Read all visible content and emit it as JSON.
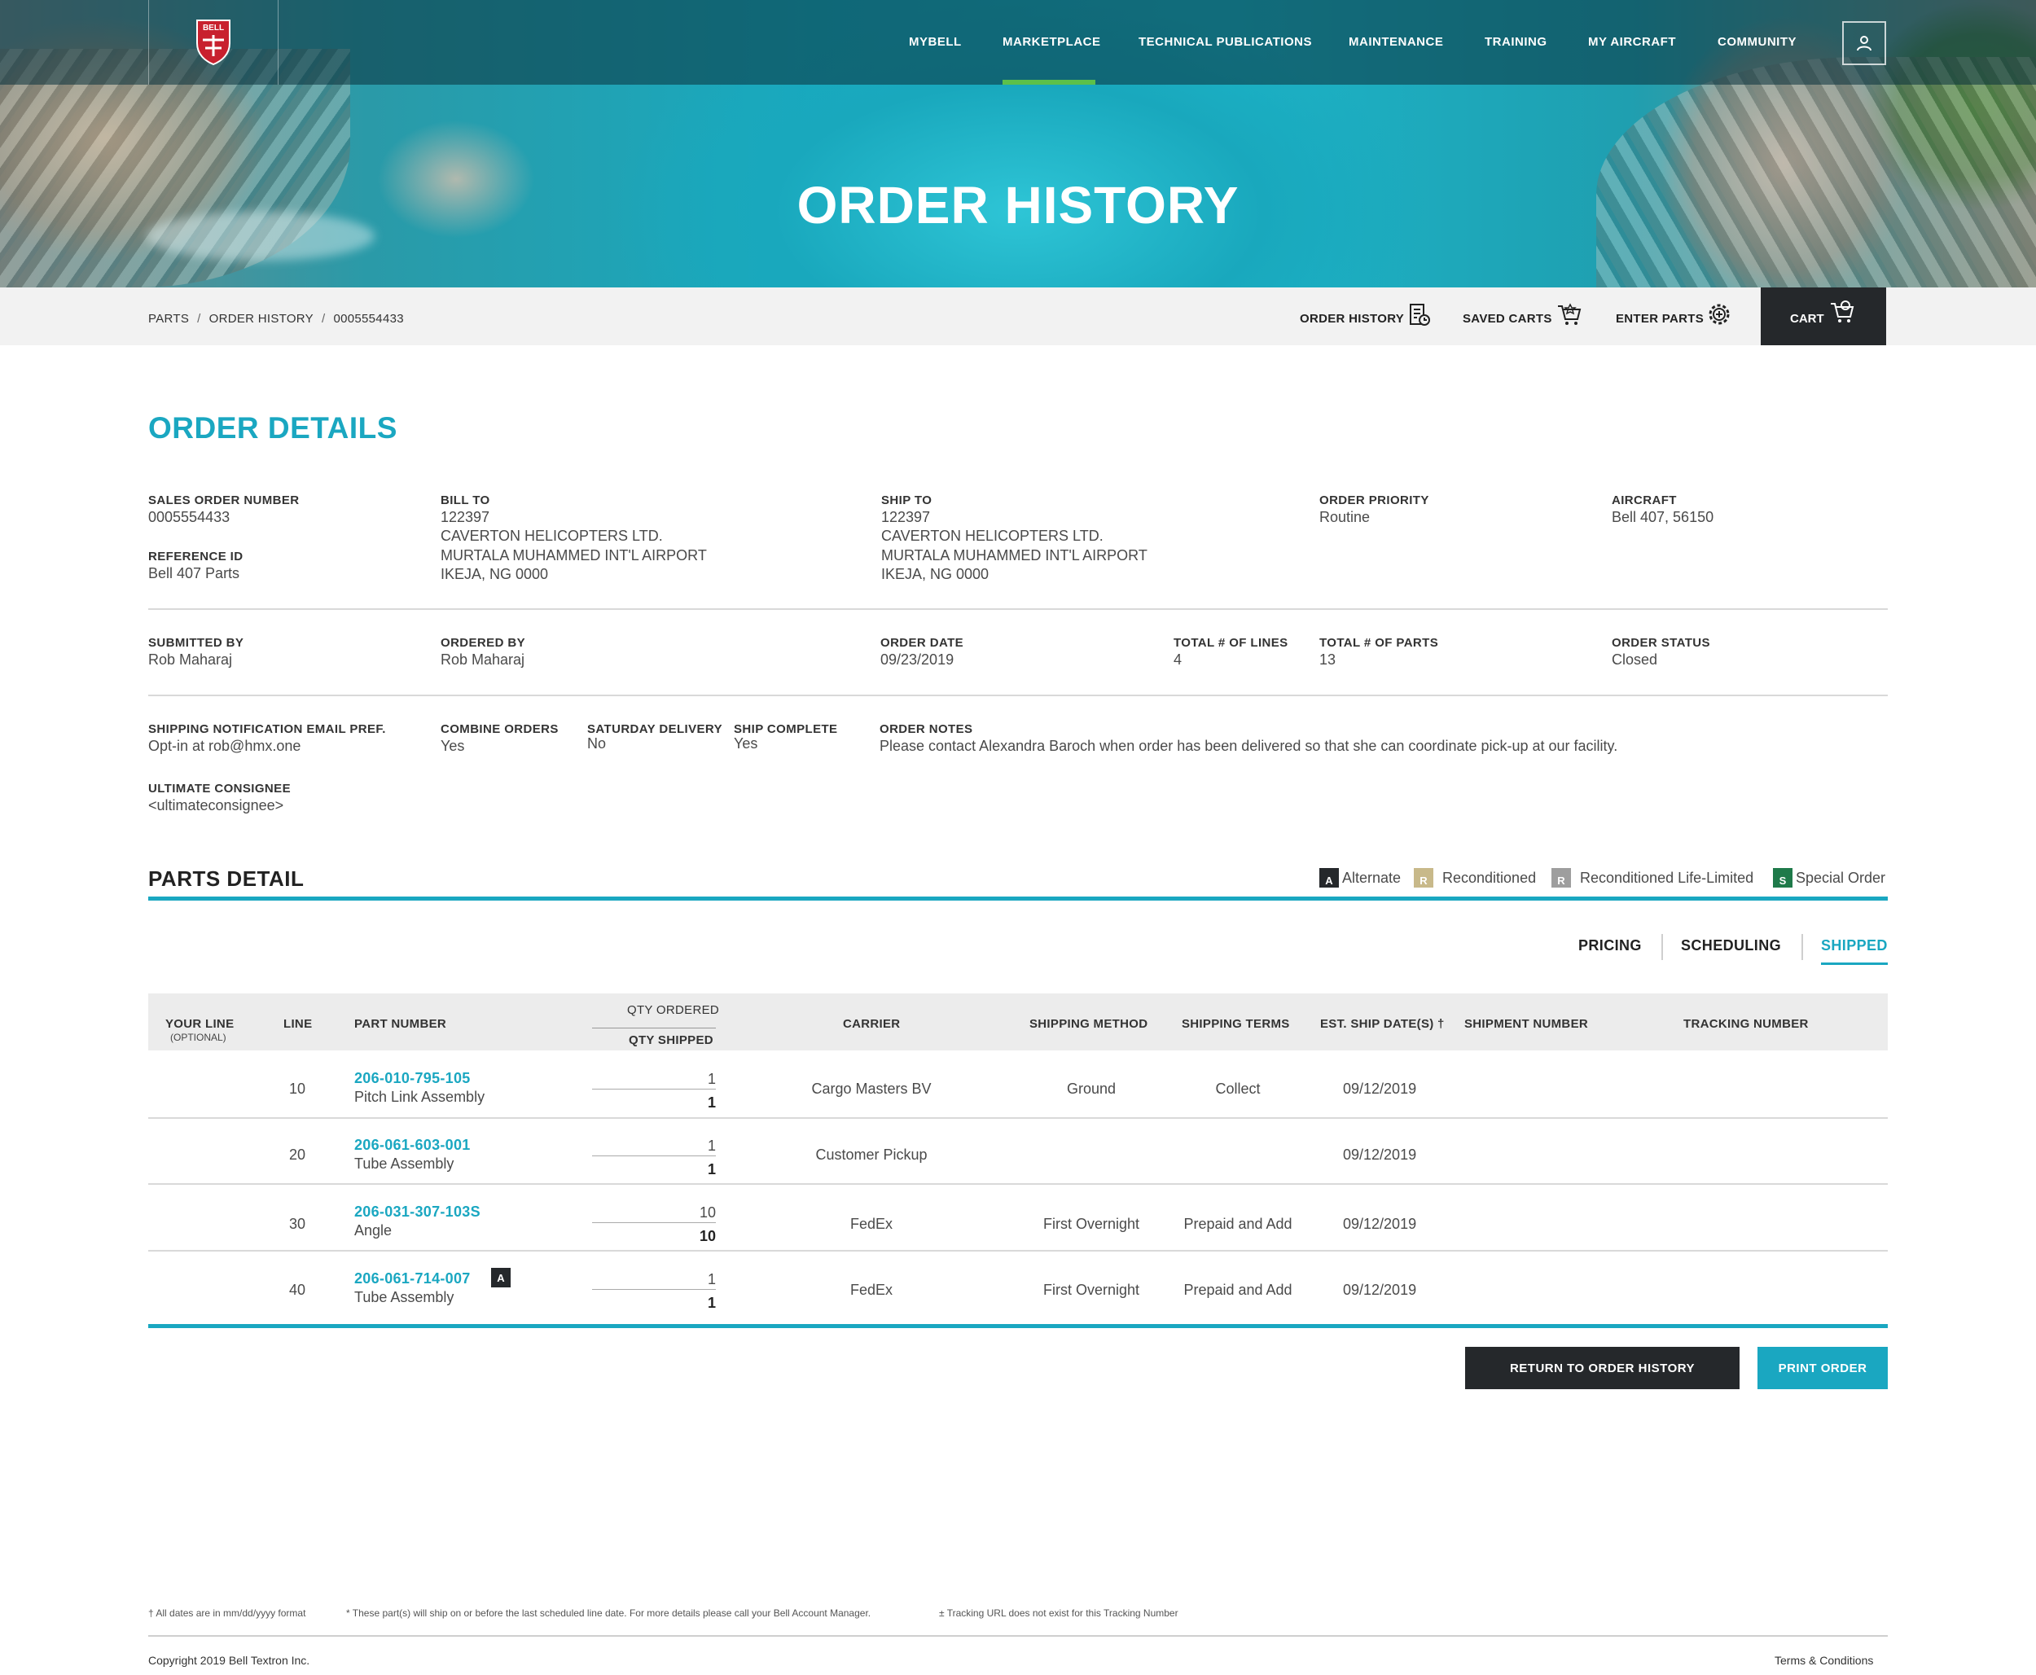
{
  "brand": {
    "logo_text": "BELL"
  },
  "nav": {
    "items": [
      "MYBELL",
      "MARKETPLACE",
      "TECHNICAL PUBLICATIONS",
      "MAINTENANCE",
      "TRAINING",
      "MY AIRCRAFT",
      "COMMUNITY"
    ],
    "active": "MARKETPLACE"
  },
  "hero": {
    "title": "ORDER HISTORY"
  },
  "breadcrumb": [
    "PARTS",
    "ORDER HISTORY",
    "0005554433"
  ],
  "utility": {
    "order_history": "ORDER HISTORY",
    "saved_carts": "SAVED CARTS",
    "enter_parts": "ENTER PARTS",
    "cart": "CART"
  },
  "order_details": {
    "heading": "ORDER DETAILS",
    "sales_order_number": {
      "label": "SALES ORDER NUMBER",
      "value": "0005554433"
    },
    "reference_id": {
      "label": "REFERENCE ID",
      "value": "Bell 407 Parts"
    },
    "bill_to": {
      "label": "BILL TO",
      "lines": [
        "122397",
        "CAVERTON HELICOPTERS LTD.",
        "MURTALA MUHAMMED INT'L AIRPORT",
        "IKEJA, NG 0000"
      ]
    },
    "ship_to": {
      "label": "SHIP TO",
      "lines": [
        "122397",
        "CAVERTON HELICOPTERS LTD.",
        "MURTALA MUHAMMED INT'L AIRPORT",
        "IKEJA, NG 0000"
      ]
    },
    "order_priority": {
      "label": "ORDER PRIORITY",
      "value": "Routine"
    },
    "aircraft": {
      "label": "AIRCRAFT",
      "value": "Bell 407, 56150"
    },
    "submitted_by": {
      "label": "SUBMITTED BY",
      "value": "Rob Maharaj"
    },
    "ordered_by": {
      "label": "ORDERED BY",
      "value": "Rob Maharaj"
    },
    "order_date": {
      "label": "ORDER DATE",
      "value": "09/23/2019"
    },
    "total_lines": {
      "label": "TOTAL # OF LINES",
      "value": "4"
    },
    "total_parts": {
      "label": "TOTAL # OF PARTS",
      "value": "13"
    },
    "order_status": {
      "label": "ORDER STATUS",
      "value": "Closed"
    },
    "shipping_email": {
      "label": "SHIPPING NOTIFICATION EMAIL PREF.",
      "value": "Opt-in at rob@hmx.one"
    },
    "combine_orders": {
      "label": "COMBINE ORDERS",
      "value": "Yes"
    },
    "saturday_delivery": {
      "label": "SATURDAY DELIVERY",
      "value": "No"
    },
    "ship_complete": {
      "label": "SHIP COMPLETE",
      "value": "Yes"
    },
    "order_notes": {
      "label": "ORDER NOTES",
      "value": "Please contact Alexandra Baroch when order has been delivered so that she can coordinate pick-up at our facility."
    },
    "ultimate_consignee": {
      "label": "ULTIMATE CONSIGNEE",
      "value": "<ultimateconsignee>"
    }
  },
  "parts_detail": {
    "heading": "PARTS DETAIL",
    "legend": [
      {
        "letter": "A",
        "label": "Alternate",
        "color": "#25282b"
      },
      {
        "letter": "R",
        "label": "Reconditioned",
        "color": "#c8b98a"
      },
      {
        "letter": "R",
        "label": "Reconditioned Life-Limited",
        "color": "#9e9e9e"
      },
      {
        "letter": "S",
        "label": "Special Order",
        "color": "#1f7a4a"
      }
    ],
    "tabs": [
      "PRICING",
      "SCHEDULING",
      "SHIPPED"
    ],
    "active_tab": "SHIPPED",
    "columns": {
      "your_line": "YOUR LINE",
      "your_line_sub": "(OPTIONAL)",
      "line": "LINE",
      "part_number": "PART NUMBER",
      "qty_ordered": "QTY ORDERED",
      "qty_shipped": "QTY SHIPPED",
      "carrier": "CARRIER",
      "shipping_method": "SHIPPING METHOD",
      "shipping_terms": "SHIPPING TERMS",
      "est_ship_date": "EST. SHIP DATE(S) †",
      "shipment_number": "SHIPMENT NUMBER",
      "tracking_number": "TRACKING NUMBER"
    },
    "rows": [
      {
        "line": "10",
        "part_number": "206-010-795-105",
        "description": "Pitch Link Assembly",
        "qty_ordered": "1",
        "qty_shipped": "1",
        "carrier": "Cargo Masters BV",
        "shipping_method": "Ground",
        "shipping_terms": "Collect",
        "est_ship_date": "09/12/2019",
        "badge": ""
      },
      {
        "line": "20",
        "part_number": "206-061-603-001",
        "description": "Tube Assembly",
        "qty_ordered": "1",
        "qty_shipped": "1",
        "carrier": "Customer Pickup",
        "shipping_method": "",
        "shipping_terms": "",
        "est_ship_date": "09/12/2019",
        "badge": ""
      },
      {
        "line": "30",
        "part_number": "206-031-307-103S",
        "description": "Angle",
        "qty_ordered": "10",
        "qty_shipped": "10",
        "carrier": "FedEx",
        "shipping_method": "First Overnight",
        "shipping_terms": "Prepaid and Add",
        "est_ship_date": "09/12/2019",
        "badge": ""
      },
      {
        "line": "40",
        "part_number": "206-061-714-007",
        "description": "Tube Assembly",
        "qty_ordered": "1",
        "qty_shipped": "1",
        "carrier": "FedEx",
        "shipping_method": "First Overnight",
        "shipping_terms": "Prepaid and Add",
        "est_ship_date": "09/12/2019",
        "badge": "A"
      }
    ]
  },
  "actions": {
    "return": "RETURN TO ORDER HISTORY",
    "print": "PRINT ORDER"
  },
  "footer": {
    "notes": [
      "† All dates are in mm/dd/yyyy format",
      "* These part(s) will ship on or before the last scheduled line date. For more details please call your Bell Account Manager.",
      "± Tracking URL does not exist for this Tracking Number"
    ],
    "copyright": "Copyright 2019 Bell Textron Inc.",
    "terms": "Terms & Conditions"
  },
  "colors": {
    "accent": "#1aa7c1",
    "nav_active": "#5cc04a",
    "dark": "#25282b"
  }
}
